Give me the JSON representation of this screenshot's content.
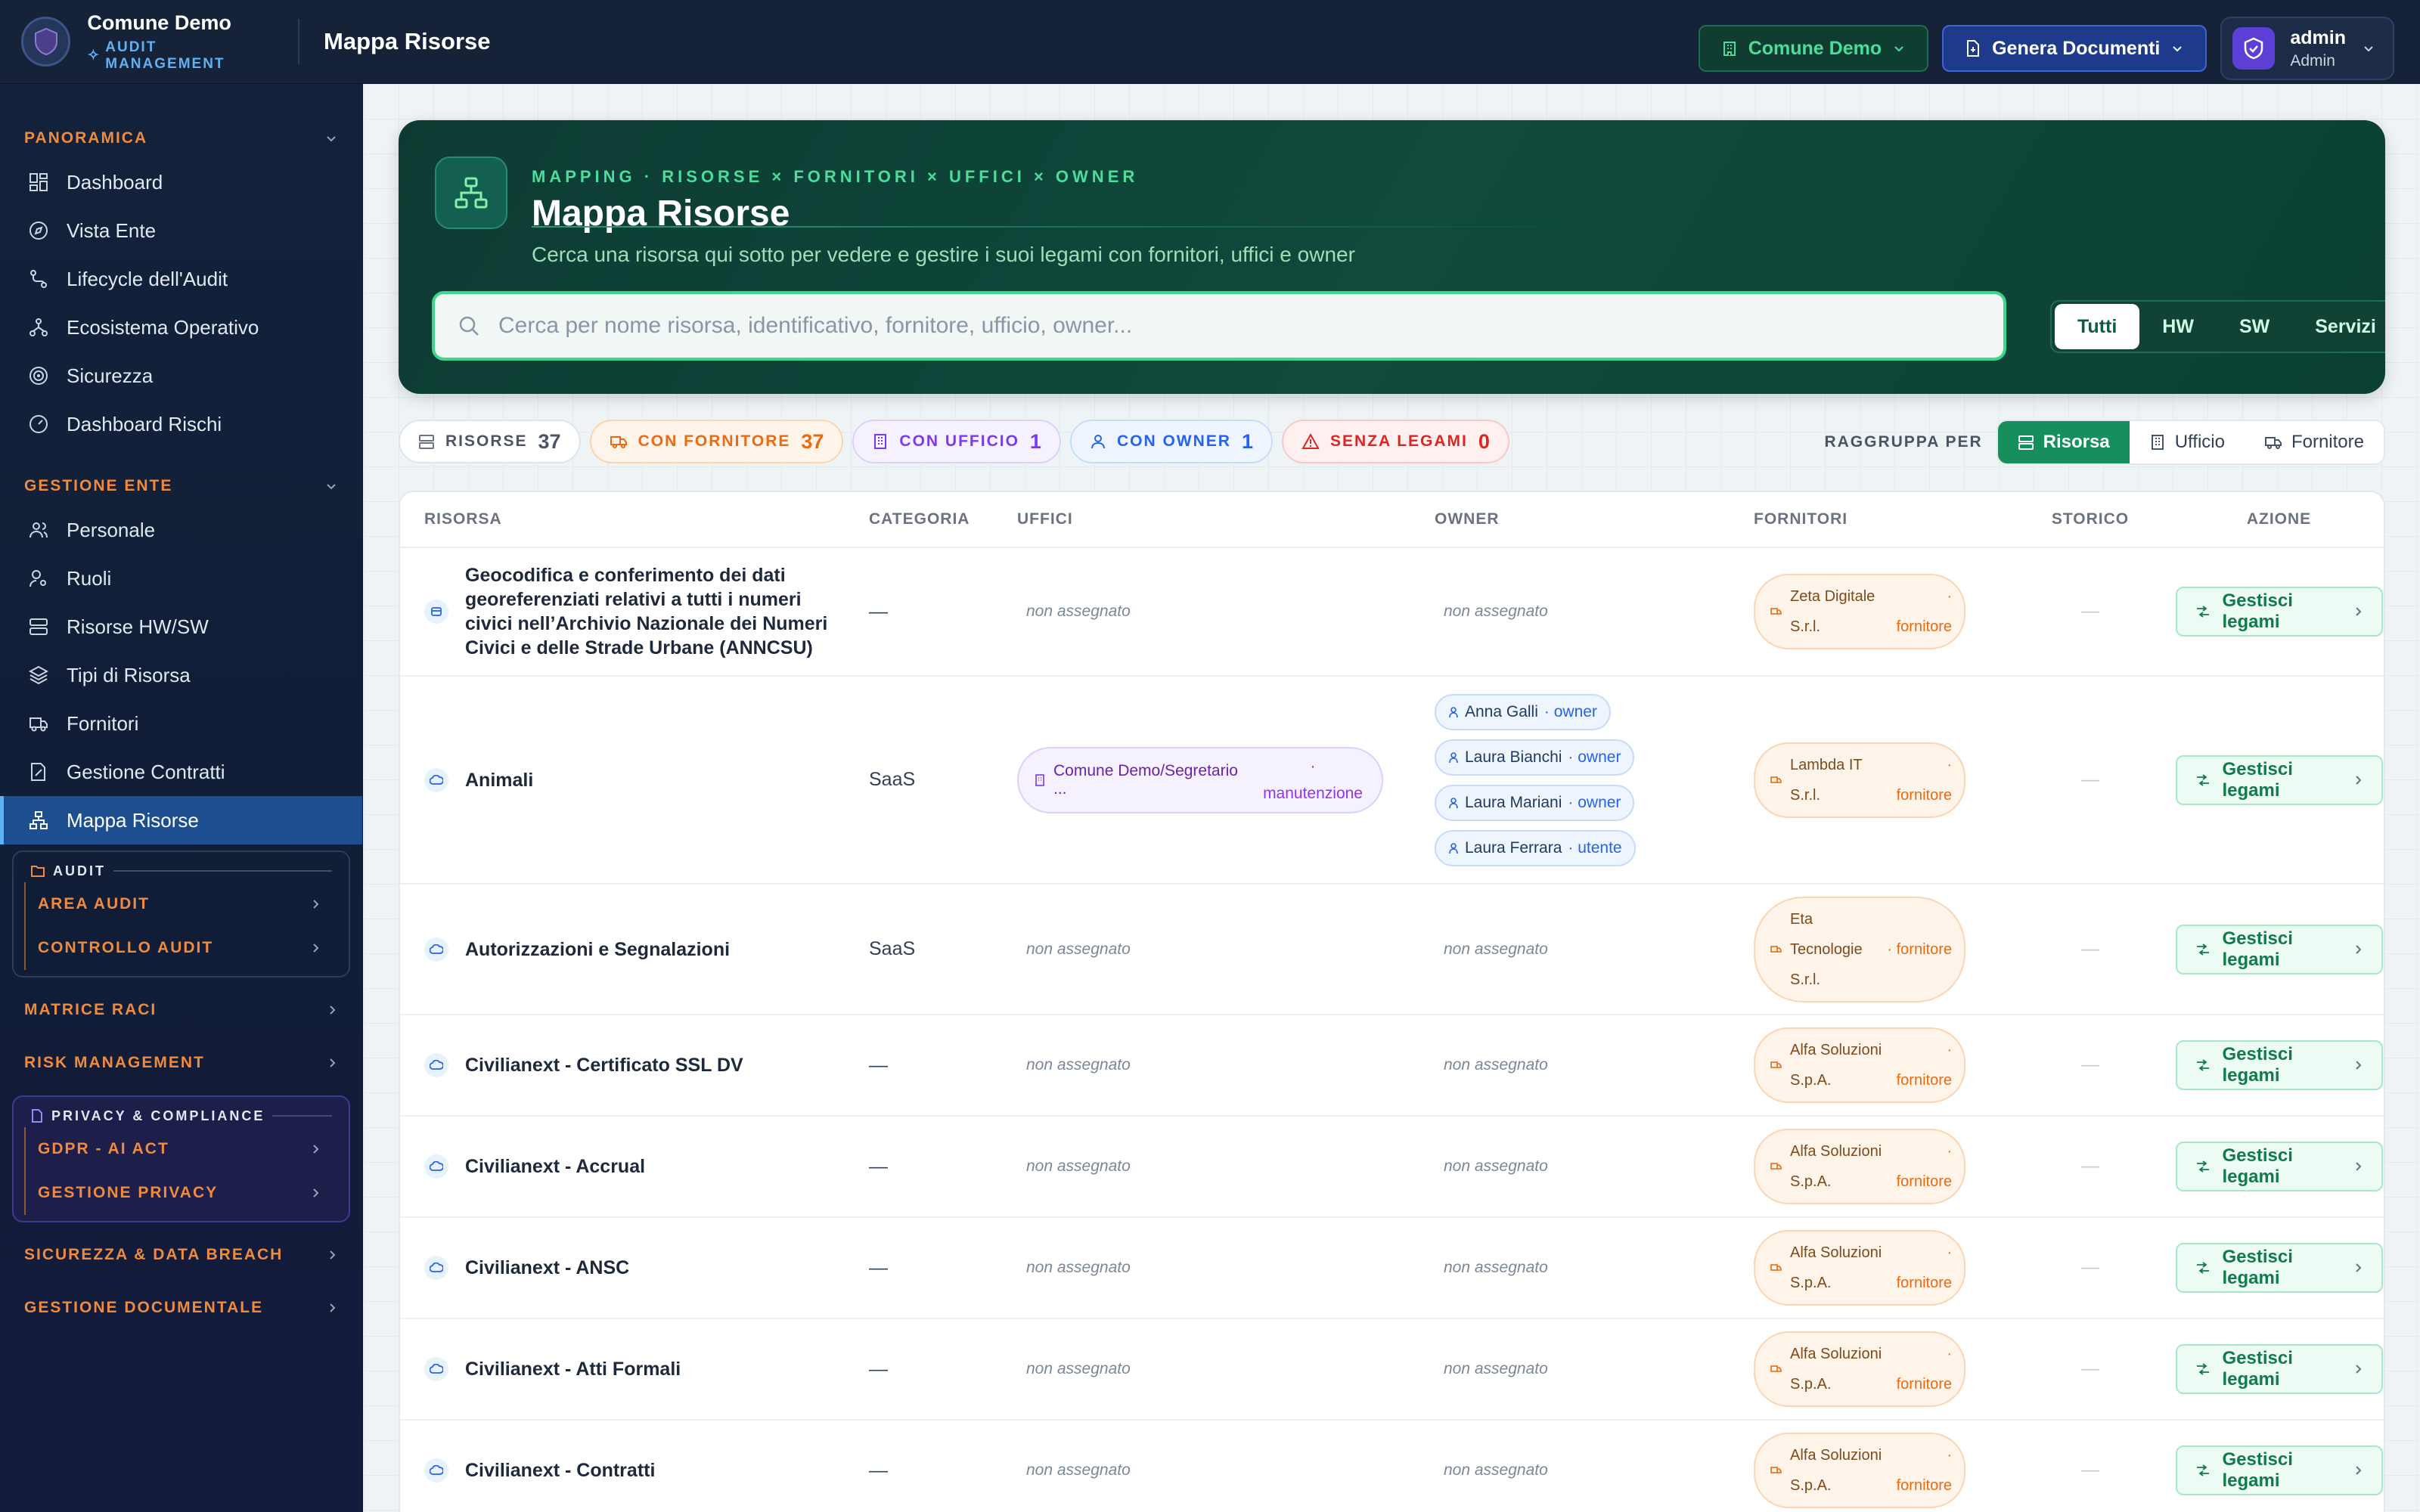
{
  "app": {
    "name": "Comune Demo",
    "subtitle": "AUDIT MANAGEMENT",
    "page_title": "Mappa Risorse"
  },
  "top": {
    "ente_label": "Comune Demo",
    "genera_label": "Genera Documenti",
    "user_name": "admin",
    "user_role": "Admin"
  },
  "sidebar": {
    "panoramica": {
      "title": "PANORAMICA",
      "items": [
        "Dashboard",
        "Vista Ente",
        "Lifecycle dell'Audit",
        "Ecosistema Operativo",
        "Sicurezza",
        "Dashboard Rischi"
      ]
    },
    "gestione": {
      "title": "GESTIONE ENTE",
      "items": [
        "Personale",
        "Ruoli",
        "Risorse HW/SW",
        "Tipi di Risorsa",
        "Fornitori",
        "Gestione Contratti",
        "Mappa Risorse"
      ]
    },
    "audit": {
      "title": "AUDIT",
      "items": [
        "AREA AUDIT",
        "CONTROLLO AUDIT"
      ]
    },
    "matrice": "MATRICE RACI",
    "risk": "RISK MANAGEMENT",
    "privacy": {
      "title": "PRIVACY & COMPLIANCE",
      "items": [
        "GDPR - AI ACT",
        "GESTIONE PRIVACY"
      ]
    },
    "sicurezza": "SICUREZZA & DATA BREACH",
    "documentale": "GESTIONE DOCUMENTALE"
  },
  "hero": {
    "kicker": "MAPPING · RISORSE × FORNITORI × UFFICI × OWNER",
    "title": "Mappa Risorse",
    "subtitle": "Cerca una risorsa qui sotto per vedere e gestire i suoi legami con fornitori, uffici e owner",
    "search_placeholder": "Cerca per nome risorsa, identificativo, fornitore, ufficio, owner...",
    "filters": [
      "Tutti",
      "HW",
      "SW",
      "Servizi"
    ]
  },
  "stats": [
    {
      "label": "RISORSE",
      "value": "37"
    },
    {
      "label": "CON FORNITORE",
      "value": "37"
    },
    {
      "label": "CON UFFICIO",
      "value": "1"
    },
    {
      "label": "CON OWNER",
      "value": "1"
    },
    {
      "label": "SENZA LEGAMI",
      "value": "0"
    }
  ],
  "group_by": {
    "label": "RAGGRUPPA PER",
    "options": [
      "Risorsa",
      "Ufficio",
      "Fornitore"
    ]
  },
  "table": {
    "headers": [
      "RISORSA",
      "CATEGORIA",
      "UFFICI",
      "OWNER",
      "FORNITORI",
      "STORICO",
      "AZIONE"
    ],
    "unassigned": "non assegnato",
    "dash": "—",
    "action_label": "Gestisci legami",
    "rows": [
      {
        "name": "Geocodifica e conferimento dei dati georeferenziati relativi a tutti i numeri civici nell’Archivio Nazionale dei Numeri Civici e delle Strade Urbane (ANNCSU)",
        "category": "—",
        "supplier": "Zeta Digitale S.r.l.",
        "supplier_role": "· fornitore"
      },
      {
        "name": "Animali",
        "category": "SaaS",
        "office": "Comune Demo/Segretario ...",
        "office_role": "· manutenzione",
        "owners": [
          {
            "name": "Anna Galli",
            "role": "· owner"
          },
          {
            "name": "Laura Bianchi",
            "role": "· owner"
          },
          {
            "name": "Laura Mariani",
            "role": "· owner"
          },
          {
            "name": "Laura Ferrara",
            "role": "· utente"
          }
        ],
        "supplier": "Lambda IT S.r.l.",
        "supplier_role": "· fornitore"
      },
      {
        "name": "Autorizzazioni e Segnalazioni",
        "category": "SaaS",
        "supplier": "Eta Tecnologie S.r.l.",
        "supplier_role": "· fornitore"
      },
      {
        "name": "Civilianext - Certificato SSL DV",
        "category": "—",
        "supplier": "Alfa Soluzioni S.p.A.",
        "supplier_role": "· fornitore"
      },
      {
        "name": "Civilianext - Accrual",
        "category": "—",
        "supplier": "Alfa Soluzioni S.p.A.",
        "supplier_role": "· fornitore"
      },
      {
        "name": "Civilianext - ANSC",
        "category": "—",
        "supplier": "Alfa Soluzioni S.p.A.",
        "supplier_role": "· fornitore"
      },
      {
        "name": "Civilianext - Atti Formali",
        "category": "—",
        "supplier": "Alfa Soluzioni S.p.A.",
        "supplier_role": "· fornitore"
      },
      {
        "name": "Civilianext - Contratti",
        "category": "—",
        "supplier": "Alfa Soluzioni S.p.A.",
        "supplier_role": "· fornitore"
      }
    ]
  }
}
